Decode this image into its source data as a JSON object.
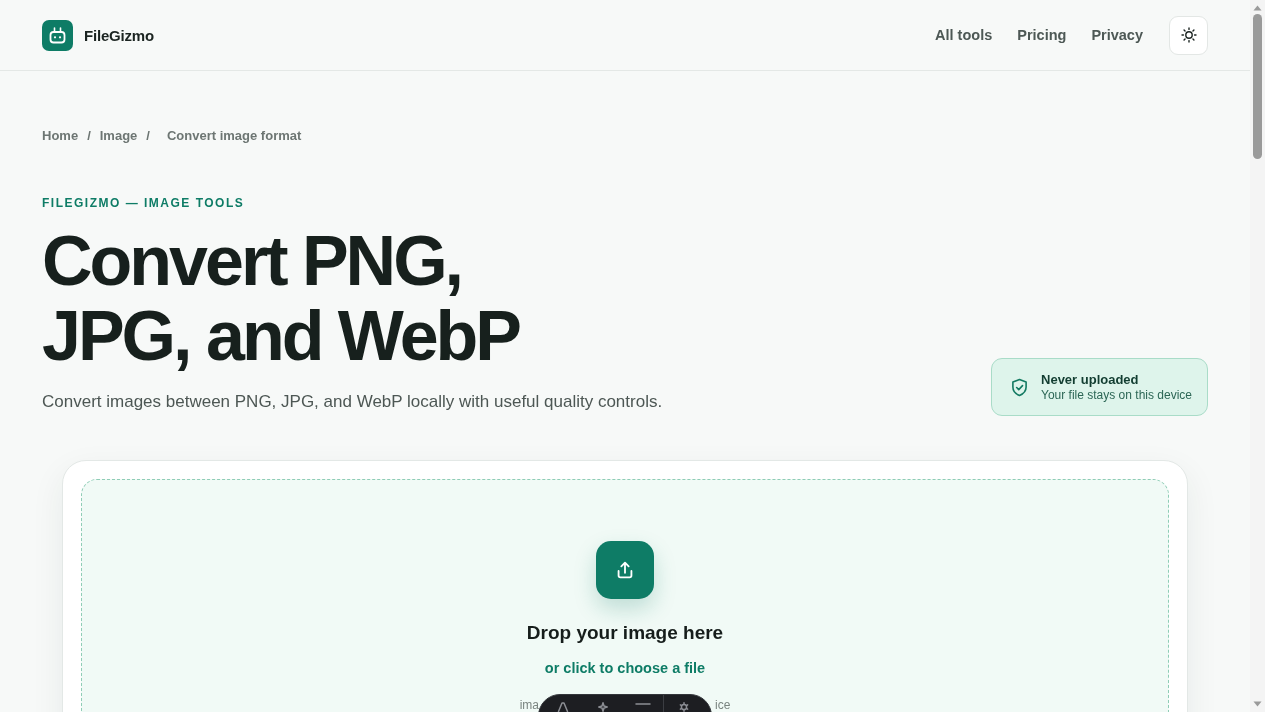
{
  "header": {
    "brand": "FileGizmo",
    "nav": [
      {
        "label": "All tools"
      },
      {
        "label": "Pricing"
      },
      {
        "label": "Privacy"
      }
    ]
  },
  "breadcrumb": [
    {
      "label": "Home",
      "separator": "/"
    },
    {
      "label": "Image",
      "separator": "/"
    },
    {
      "label": "Convert image format"
    }
  ],
  "hero": {
    "eyebrow": "FILEGIZMO — IMAGE TOOLS",
    "title": "Convert PNG, JPG, and WebP",
    "subtitle": "Convert images between PNG, JPG, and WebP locally with useful quality controls.",
    "privacy_note": {
      "title": "Never uploaded",
      "text": "Your file stays on this device"
    }
  },
  "dropzone": {
    "title": "Drop your image here",
    "action": "or click to choose a file",
    "hint_fragments": [
      "ima",
      "ice"
    ]
  }
}
